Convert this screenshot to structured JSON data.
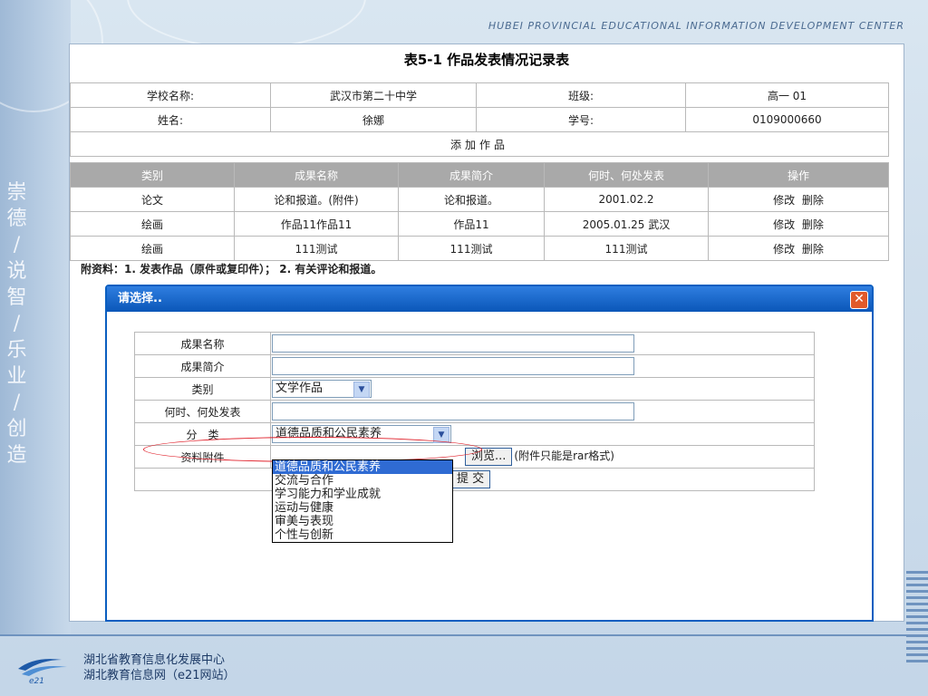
{
  "header": {
    "org_en": "HUBEI PROVINCIAL EDUCATIONAL INFORMATION DEVELOPMENT CENTER"
  },
  "side_text": [
    "崇",
    "德",
    "/",
    "说",
    "智",
    "/",
    "乐",
    "业",
    "/",
    "创",
    "造"
  ],
  "footer": {
    "line1": "湖北省教育信息化发展中心",
    "line2": "湖北教育信息网（e21网站）",
    "logo_text": "e21"
  },
  "main": {
    "title": "表5-1 作品发表情况记录表",
    "info": {
      "school_label": "学校名称:",
      "school_value": "武汉市第二十中学",
      "class_label": "班级:",
      "class_value": "高一 01",
      "name_label": "姓名:",
      "name_value": "徐娜",
      "id_label": "学号:",
      "id_value": "0109000660"
    },
    "add_work": "添加作品",
    "columns": [
      "类别",
      "成果名称",
      "成果简介",
      "何时、何处发表",
      "操作"
    ],
    "rows": [
      {
        "category": "论文",
        "name": "论和报道。(附件)",
        "intro": "论和报道。",
        "when_where": "2001.02.2",
        "edit": "修改",
        "delete": "删除"
      },
      {
        "category": "绘画",
        "name": "作品11作品11",
        "intro": "作品11",
        "when_where": "2005.01.25 武汉",
        "edit": "修改",
        "delete": "删除"
      },
      {
        "category": "绘画",
        "name": "111测试",
        "intro": "111测试",
        "when_where": "111测试",
        "edit": "修改",
        "delete": "删除"
      }
    ],
    "note": "附资料：1. 发表作品（原件或复印件）； 2. 有关评论和报道。"
  },
  "dialog": {
    "title": "请选择..",
    "close_glyph": "✕",
    "labels": {
      "name": "成果名称",
      "intro": "成果简介",
      "category": "类别",
      "when_where": "何时、何处发表",
      "classification": "分　类",
      "attachment": "资料附件"
    },
    "category_select": "文学作品",
    "classification_select": "道德品质和公民素养",
    "browse_label": "浏览...",
    "attachment_hint": "(附件只能是rar格式)",
    "submit_label": "提 交",
    "dropdown_options": [
      "道德品质和公民素养",
      "交流与合作",
      "学习能力和学业成就",
      "运动与健康",
      "审美与表现",
      "个性与创新"
    ],
    "dropdown_selected": "道德品质和公民素养",
    "colors": {
      "title_bar": "#0a56b8",
      "highlight": "#2f6bd3",
      "ellipse": "#e0202a"
    }
  }
}
